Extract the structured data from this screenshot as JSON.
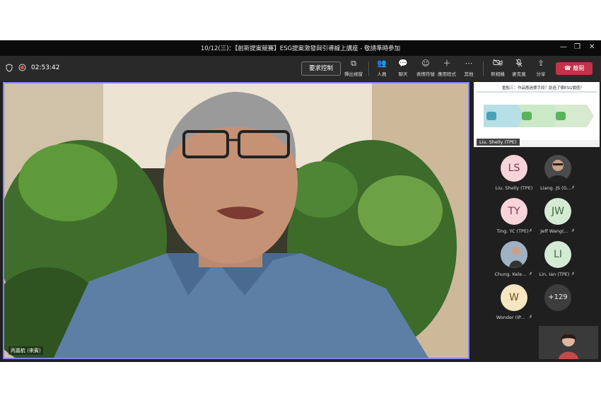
{
  "window": {
    "title": "10/12(三)：【創新提案競賽】ESG提案激發與引導線上講座 - 敬請準時參加"
  },
  "toolbar": {
    "timer": "02:53:42",
    "request_control": "要求控制",
    "popout": "彈出視窗",
    "people": "人員",
    "chat": "聊天",
    "reactions": "表情符號",
    "apps": "應用程式",
    "more": "其他",
    "camera": "照相機",
    "mic": "麥克風",
    "share": "分享",
    "leave": "離開"
  },
  "main_video": {
    "speaker_name": "丙嘉航 (來賓)"
  },
  "shared_content": {
    "question": "重點三：作品應過哪手段？創造了哪ESG價值？",
    "presenter_tag": "Liu. Shelly (TPE)"
  },
  "participants": [
    {
      "initials": "LS",
      "name": "Liu. Shelly (TPE)",
      "color": "#f7d3da",
      "mic": ""
    },
    {
      "initials": "",
      "name": "Liang. JS (G...",
      "color": "#555555",
      "mic": "🎙"
    },
    {
      "initials": "TY",
      "name": "Ting. YC (TPE)",
      "color": "#f7d3da",
      "mic": "🎙"
    },
    {
      "initials": "JW",
      "name": "Jeff Wang(...",
      "color": "#d5ead4",
      "mic": "🎙"
    },
    {
      "initials": "",
      "name": "Chung. Kele...",
      "color": "#555555",
      "mic": "🎙"
    },
    {
      "initials": "LI",
      "name": "Lin. Ian (TPE)",
      "color": "#d5ead4",
      "mic": "🎙"
    },
    {
      "initials": "W",
      "name": "Wonder (IP...",
      "color": "#f6e6c2",
      "mic": "🎙"
    },
    {
      "initials": "+129",
      "name": "",
      "color": "#3d3d3d",
      "mic": ""
    }
  ],
  "icons": {
    "shield": "shield-icon",
    "record": "record-icon",
    "popout": "popout-icon",
    "people": "people-icon",
    "chat": "chat-icon",
    "reactions": "smiley-icon",
    "apps": "plus-icon",
    "more": "more-icon",
    "camera": "camera-off-icon",
    "mic": "mic-off-icon",
    "share": "share-icon",
    "leave": "phone-icon"
  }
}
